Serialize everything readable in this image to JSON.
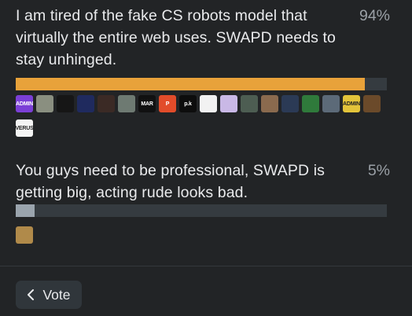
{
  "poll": {
    "options": [
      {
        "text": "I am tired of the fake CS robots model that virtually the entire web uses. SWAPD needs to stay unhinged.",
        "percent_label": "94%",
        "percent": 94,
        "bar_color": "#e8a23a",
        "voters": [
          {
            "label": "ADMIN",
            "bg": "#7b3fd6"
          },
          {
            "label": "",
            "bg": "#8a8f80"
          },
          {
            "label": "",
            "bg": "#161616"
          },
          {
            "label": "",
            "bg": "#1f2a5e"
          },
          {
            "label": "",
            "bg": "#3b2a25"
          },
          {
            "label": "",
            "bg": "#6e7a72"
          },
          {
            "label": "MAR",
            "bg": "#111111"
          },
          {
            "label": "P",
            "bg": "#e24c2a"
          },
          {
            "label": "p.k",
            "bg": "#0d0d0d"
          },
          {
            "label": "",
            "bg": "#f2f2f2"
          },
          {
            "label": "",
            "bg": "#c9b8e6"
          },
          {
            "label": "",
            "bg": "#4d5d52"
          },
          {
            "label": "",
            "bg": "#8a6a4e"
          },
          {
            "label": "",
            "bg": "#2b3a55"
          },
          {
            "label": "",
            "bg": "#2f7a3b"
          },
          {
            "label": "",
            "bg": "#5c6a78"
          },
          {
            "label": "ADMIN",
            "bg": "#e3c43a"
          },
          {
            "label": "",
            "bg": "#6b4a2a"
          },
          {
            "label": "VERUS",
            "bg": "#f4f4f4"
          }
        ]
      },
      {
        "text": "You guys need to be professional, SWAPD is getting big, acting rude looks bad.",
        "percent_label": "5%",
        "percent": 5,
        "bar_color": "#9aa4ad",
        "voters": [
          {
            "label": "",
            "bg": "#b08a4a"
          }
        ]
      }
    ]
  },
  "footer": {
    "vote_label": "Vote"
  },
  "icons": {
    "vote_button_icon": "chevron-left-icon"
  }
}
